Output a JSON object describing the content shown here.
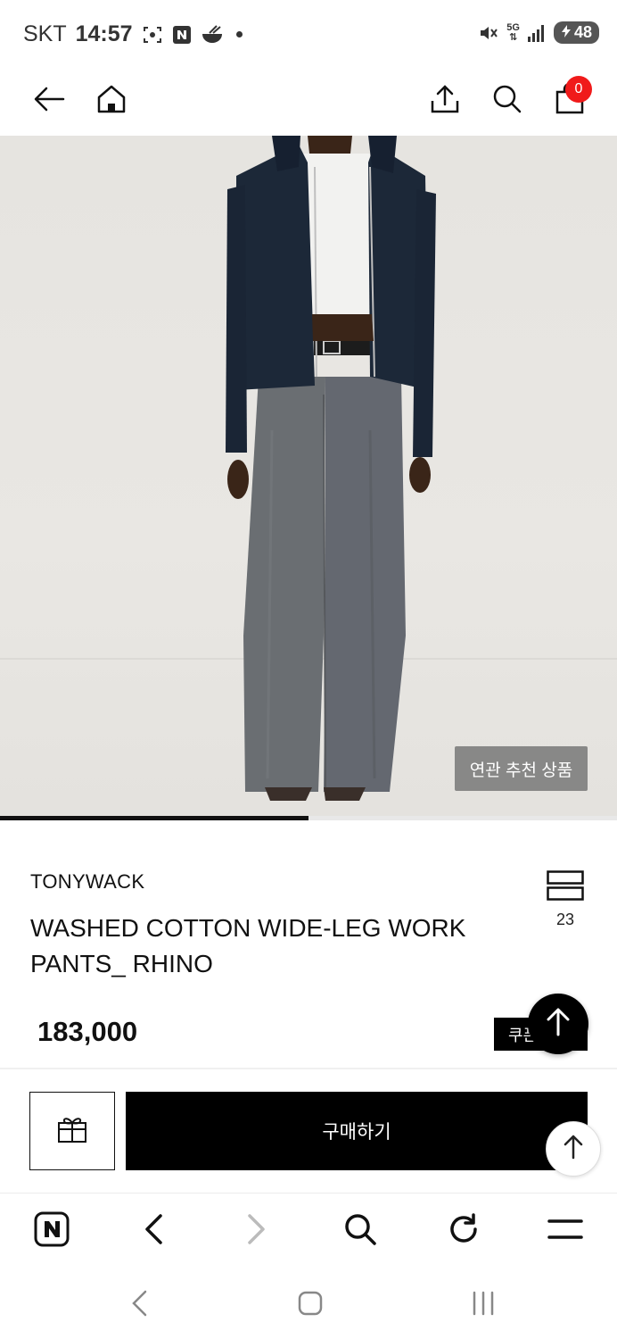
{
  "status_bar": {
    "carrier": "SKT",
    "time": "14:57",
    "network": "5G",
    "battery": "48"
  },
  "header": {
    "cart_count": "0"
  },
  "hero": {
    "related_button": "연관 추천 상품",
    "gallery_progress": 0.5
  },
  "product": {
    "brand": "TONYWACK",
    "name": "WASHED COTTON WIDE-LEG WORK PANTS_ RHINO",
    "like_count": "23",
    "price": "183,000",
    "coupon_label": "쿠폰"
  },
  "actions": {
    "buy_label": "구매하기"
  },
  "icons": {
    "header": [
      "back-icon",
      "home-icon",
      "share-icon",
      "search-icon",
      "cart-icon"
    ],
    "browser": [
      "naver-icon",
      "back-icon",
      "forward-icon",
      "search-icon",
      "refresh-icon",
      "menu-icon"
    ],
    "android": [
      "back-icon",
      "home-icon",
      "recents-icon"
    ]
  },
  "colors": {
    "badge": "#f01a1a",
    "primary": "#000000",
    "hero_bg": "#e8e6e2"
  }
}
